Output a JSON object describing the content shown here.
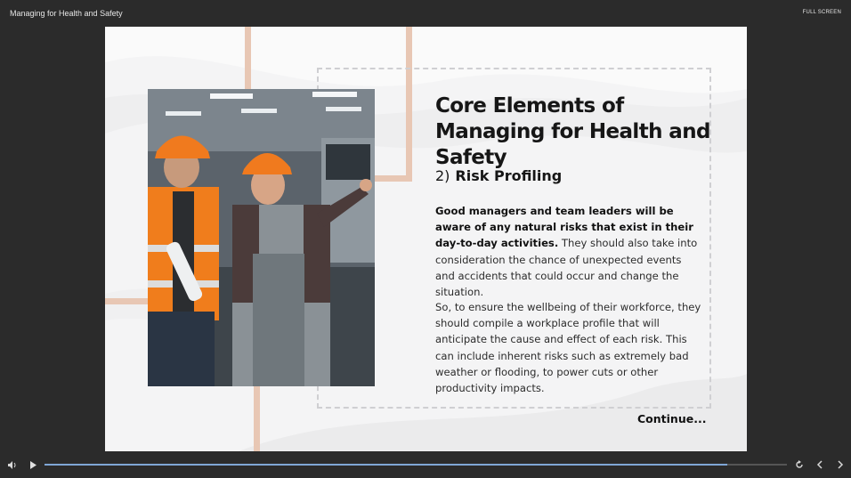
{
  "app": {
    "course_title": "Managing for Health and Safety",
    "fullscreen_label": "FULL SCREEN"
  },
  "slide": {
    "heading": "Core Elements of Managing for Health and Safety",
    "subhead_number": "2)",
    "subhead_title": "Risk Profiling",
    "para1_bold": "Good managers and team leaders will be aware of any natural risks that exist in their day-to-day activities.",
    "para1_rest": " They should also take into consideration the chance of unexpected events and accidents that could occur and change the situation.",
    "para2": "So, to ensure the wellbeing of their workforce, they should compile a workplace profile that will anticipate the cause and effect of each risk. This can include inherent risks such as extremely bad weather or flooding, to power cuts or other productivity impacts.",
    "continue_label": "Continue...",
    "image_alt_icon": "workers-photo"
  },
  "player": {
    "progress_fraction": 0.92,
    "icons": [
      "volume-icon",
      "play-icon",
      "replay-icon",
      "prev-icon",
      "next-icon"
    ],
    "accent": "#7fa6d6"
  }
}
